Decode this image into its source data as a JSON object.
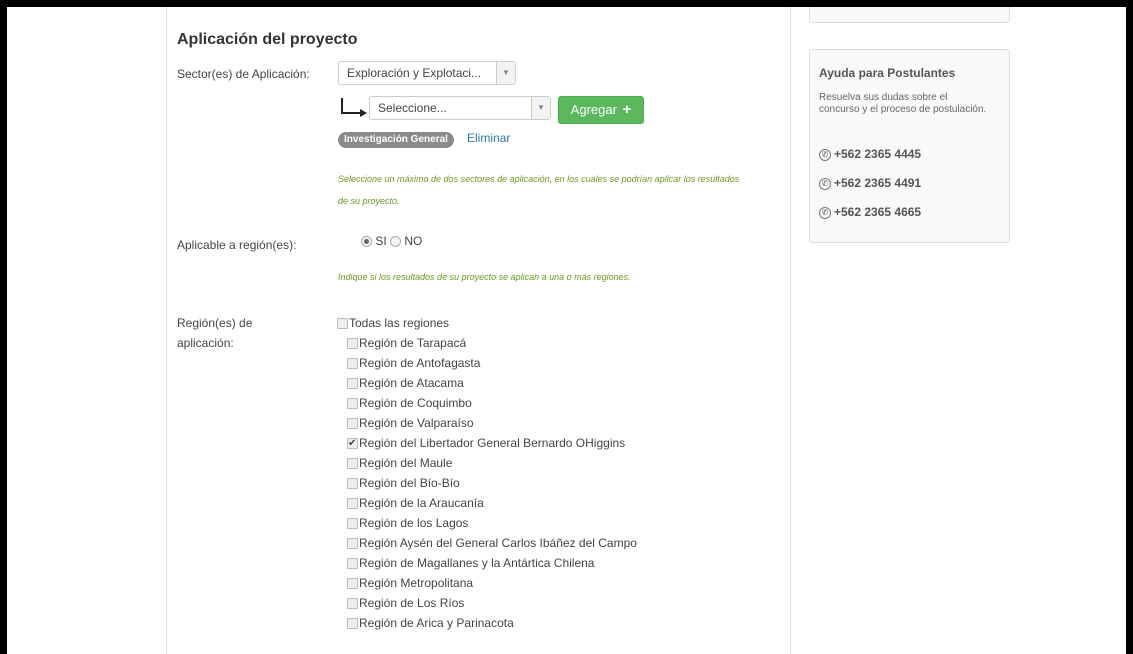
{
  "section_title": "Aplicación del proyecto",
  "sector": {
    "label": "Sector(es) de Aplicación:",
    "selected": "Exploración y Explotaci...",
    "sub_select_placeholder": "Seleccione...",
    "add_button": "Agregar",
    "add_icon": "+",
    "tag": "Investigación General",
    "remove_link": "Eliminar",
    "hint_line1": "Seleccione un máximo de dos sectores de aplicación, en los cuales se podrían aplicar los resultados",
    "hint_line2": "de su proyecto."
  },
  "region_applicable": {
    "label": "Aplicable a región(es):",
    "option_yes": "SI",
    "option_no": "NO",
    "selected": "SI",
    "hint": "Indique si los resultados de su proyecto se aplican a una o más regiones."
  },
  "regions": {
    "label_line1": "Región(es) de",
    "label_line2": "aplicación:",
    "all_label": "Todas las regiones",
    "items": [
      {
        "label": "Región de Tarapacá",
        "checked": false
      },
      {
        "label": "Región de Antofagasta",
        "checked": false
      },
      {
        "label": "Región de Atacama",
        "checked": false
      },
      {
        "label": "Región de Coquimbo",
        "checked": false
      },
      {
        "label": "Región de Valparaíso",
        "checked": false
      },
      {
        "label": "Región del Libertador General Bernardo OHiggins",
        "checked": true
      },
      {
        "label": "Región del Maule",
        "checked": false
      },
      {
        "label": "Región del Bío-Bío",
        "checked": false
      },
      {
        "label": "Región de la Araucanía",
        "checked": false
      },
      {
        "label": "Región de los Lagos",
        "checked": false
      },
      {
        "label": "Región Aysén del General Carlos Ibáñez del Campo",
        "checked": false
      },
      {
        "label": "Región de Magallanes y la Antártica Chilena",
        "checked": false
      },
      {
        "label": "Región Metropolitana",
        "checked": false
      },
      {
        "label": "Región de Los Ríos",
        "checked": false
      },
      {
        "label": "Región de Arica y Parinacota",
        "checked": false
      }
    ]
  },
  "help": {
    "title": "Ayuda para Postulantes",
    "text": "Resuelva sus dudas sobre el concurso y el proceso de postulación.",
    "phones": [
      "+562 2365 4445",
      "+562 2365 4491",
      "+562 2365 4665"
    ],
    "phone_icon": "phone-icon"
  },
  "colors": {
    "accent_green": "#5cb85c",
    "hint_green": "#6a9a1f",
    "link_blue": "#2a7ab8",
    "tag_gray": "#8a8a8a"
  }
}
